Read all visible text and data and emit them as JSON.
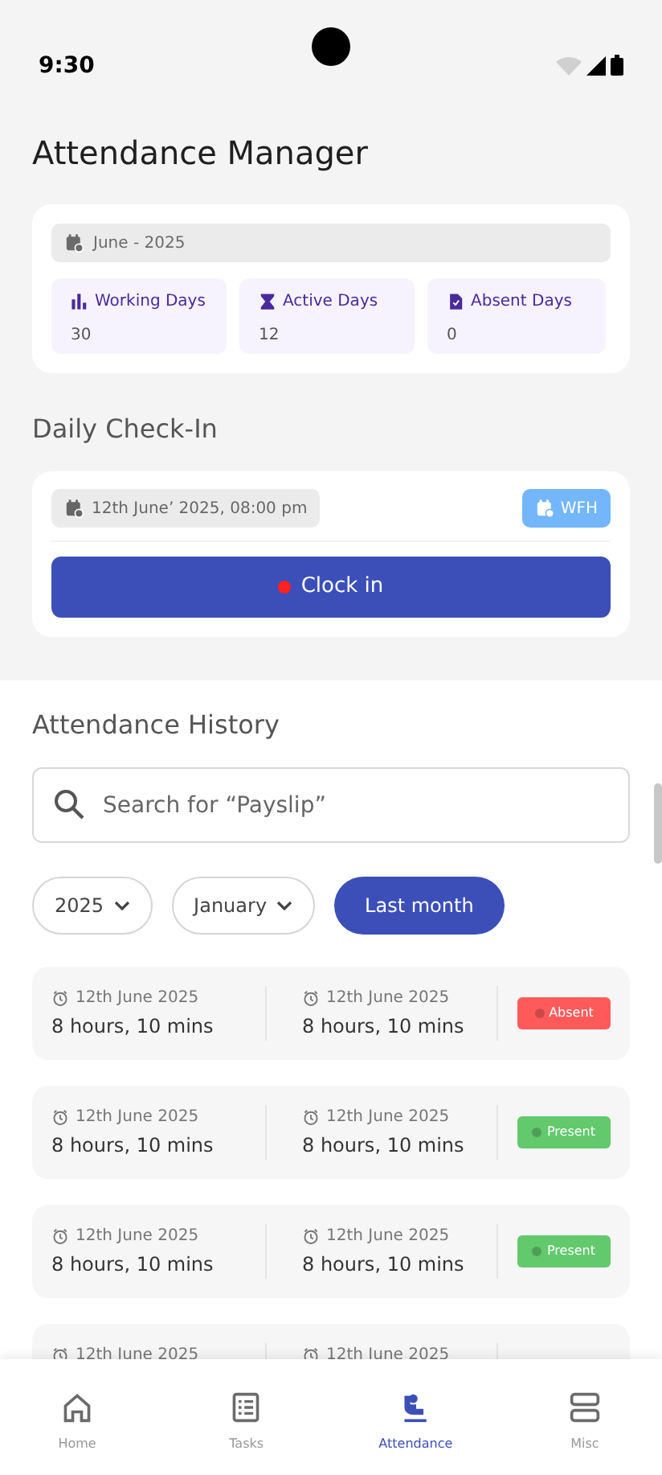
{
  "status_bar": {
    "time": "9:30"
  },
  "title": "Attendance Manager",
  "summary": {
    "period": "June - 2025",
    "stats": [
      {
        "kind": "working",
        "label": "Working Days",
        "value": "30"
      },
      {
        "kind": "active",
        "label": "Active Days",
        "value": "12"
      },
      {
        "kind": "absent",
        "label": "Absent Days",
        "value": "0"
      }
    ]
  },
  "check_in": {
    "heading": "Daily Check-In",
    "datetime": "12th June’ 2025, 08:00 pm",
    "mode": "WFH",
    "button": "Clock in"
  },
  "history": {
    "heading": "Attendance History",
    "search": {
      "placeholder": "Search for “Payslip”"
    },
    "filters": [
      {
        "label": "2025",
        "kind": "dropdown",
        "selected": false
      },
      {
        "label": "January",
        "kind": "dropdown",
        "selected": false
      },
      {
        "label": "Last month",
        "kind": "button",
        "selected": true
      }
    ],
    "rows": [
      {
        "in_date": "12th June 2025",
        "in_duration": "8 hours, 10 mins",
        "out_date": "12th June 2025",
        "out_duration": "8 hours, 10 mins",
        "status": "Absent",
        "color": "#ff5a5a"
      },
      {
        "in_date": "12th June 2025",
        "in_duration": "8 hours, 10 mins",
        "out_date": "12th June 2025",
        "out_duration": "8 hours, 10 mins",
        "status": "Present",
        "color": "#62c96c"
      },
      {
        "in_date": "12th June 2025",
        "in_duration": "8 hours, 10 mins",
        "out_date": "12th June 2025",
        "out_duration": "8 hours, 10 mins",
        "status": "Present",
        "color": "#62c96c"
      },
      {
        "in_date": "12th June 2025",
        "out_date": "12th June 2025"
      }
    ]
  },
  "nav": [
    {
      "kind": "home",
      "label": "Home",
      "selected": false
    },
    {
      "kind": "tasks",
      "label": "Tasks",
      "selected": false
    },
    {
      "kind": "attendance",
      "label": "Attendance",
      "selected": true
    },
    {
      "kind": "misc",
      "label": "Misc",
      "selected": false
    }
  ]
}
